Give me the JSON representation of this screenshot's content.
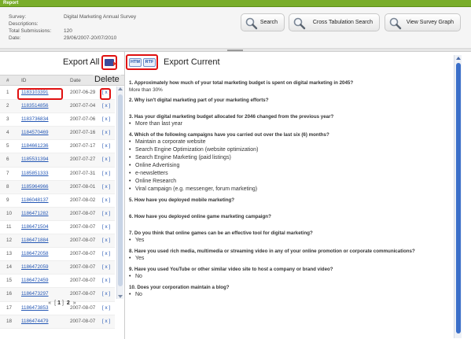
{
  "window": {
    "title": "Report"
  },
  "survey_info": {
    "survey_label": "Survey:",
    "survey_value": "Digital Marketing Annual Survey",
    "descriptions_label": "Descriptions:",
    "descriptions_value": "",
    "total_label": "Total Submissions:",
    "total_value": "120",
    "date_label": "Date:",
    "date_value": "29/06/2007-20/07/2010"
  },
  "toolbar": {
    "search_label": "Search",
    "cross_tab_label": "Cross Tabulation Search",
    "graph_label": "View Survey Graph",
    "icon": "magnifier-icon"
  },
  "left_panel": {
    "export_all_label": "Export All",
    "delete_label": "Delete",
    "columns": {
      "num": "#",
      "id": "ID",
      "date": "Date"
    },
    "rows": [
      {
        "num": "1",
        "id": "1183103391",
        "date": "2007-06-29",
        "del": "[ x ]"
      },
      {
        "num": "2",
        "id": "1183514856",
        "date": "2007-07-04",
        "del": "[ x ]"
      },
      {
        "num": "3",
        "id": "1183736834",
        "date": "2007-07-06",
        "del": "[ x ]"
      },
      {
        "num": "4",
        "id": "1184570469",
        "date": "2007-07-16",
        "del": "[ x ]"
      },
      {
        "num": "5",
        "id": "1184661236",
        "date": "2007-07-17",
        "del": "[ x ]"
      },
      {
        "num": "6",
        "id": "1185531394",
        "date": "2007-07-27",
        "del": "[ x ]"
      },
      {
        "num": "7",
        "id": "1185851333",
        "date": "2007-07-31",
        "del": "[ x ]"
      },
      {
        "num": "8",
        "id": "1185964966",
        "date": "2007-08-01",
        "del": "[ x ]"
      },
      {
        "num": "9",
        "id": "1186048137",
        "date": "2007-08-02",
        "del": "[ x ]"
      },
      {
        "num": "10",
        "id": "1186471282",
        "date": "2007-08-07",
        "del": "[ x ]"
      },
      {
        "num": "11",
        "id": "1186471504",
        "date": "2007-08-07",
        "del": "[ x ]"
      },
      {
        "num": "12",
        "id": "1186471884",
        "date": "2007-08-07",
        "del": "[ x ]"
      },
      {
        "num": "13",
        "id": "1186472058",
        "date": "2007-08-07",
        "del": "[ x ]"
      },
      {
        "num": "14",
        "id": "1186472059",
        "date": "2007-08-07",
        "del": "[ x ]"
      },
      {
        "num": "15",
        "id": "1186472459",
        "date": "2007-08-07",
        "del": "[ x ]"
      },
      {
        "num": "16",
        "id": "1186473297",
        "date": "2007-08-07",
        "del": "[ x ]"
      },
      {
        "num": "17",
        "id": "1186473853",
        "date": "2007-08-07",
        "del": "[ x ]"
      },
      {
        "num": "18",
        "id": "1186474479",
        "date": "2007-08-07",
        "del": "[ x ]"
      }
    ],
    "pager": {
      "prev": "«",
      "open": "[",
      "page1": "1",
      "close": "]",
      "page2": "2",
      "next": "»"
    }
  },
  "right_panel": {
    "htm_label": "HTM",
    "rtf_label": "RTF",
    "export_current_label": "Export Current",
    "questions": [
      {
        "q": "1. Approximately how much of your total marketing budget is spent on digital marketing in 2045?",
        "plain": "More than 30%",
        "answers": []
      },
      {
        "q": "2. Why isn't digital marketing part of your marketing efforts?",
        "plain": "",
        "answers": []
      },
      {
        "q": "3. Has your digital marketing budget allocated for 2046 changed from the previous year?",
        "plain": "",
        "answers": [
          "More than last year"
        ]
      },
      {
        "q": "4. Which of the following campaigns have you carried out over the last six (6) months?",
        "plain": "",
        "answers": [
          "Maintain a corporate website",
          "Search Engine Optimization (website optimization)",
          "Search Engine Marketing (paid listings)",
          "Online Advertising",
          "e-newsletters",
          "Online Research",
          "Viral campaign (e.g. messenger, forum marketing)"
        ]
      },
      {
        "q": "5. How have you deployed mobile marketing?",
        "plain": "",
        "answers": []
      },
      {
        "q": "6. How have you deployed online game marketing campaign?",
        "plain": "",
        "answers": []
      },
      {
        "q": "7. Do you think that online games can be an effective tool for digital marketing?",
        "plain": "",
        "answers": [
          "Yes"
        ]
      },
      {
        "q": "8. Have you used rich media, multimedia or streaming video in any of your online promotion or corporate communications?",
        "plain": "",
        "answers": [
          "Yes"
        ]
      },
      {
        "q": "9. Have you used YouTube or other similar video site to host a company or brand video?",
        "plain": "",
        "answers": [
          "No"
        ]
      },
      {
        "q": "10. Does your corporation maintain a blog?",
        "plain": "",
        "answers": [
          "No"
        ]
      }
    ]
  },
  "colors": {
    "titlebar": "#79ad2a",
    "link": "#2356b4",
    "highlight": "#e01010",
    "scroll_thumb": "#3b6fc9"
  }
}
